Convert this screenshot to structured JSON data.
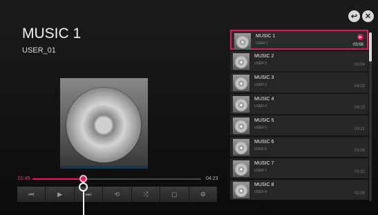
{
  "header": {
    "back_icon": "back-arrow-icon",
    "close_icon": "close-icon",
    "back_glyph": "↩",
    "close_glyph": "✕"
  },
  "now_playing": {
    "title": "MUSIC 1",
    "user": "USER_01",
    "current_time": "01:45",
    "total_time": "04:23",
    "progress": 0.3
  },
  "controls": [
    {
      "name": "previous-icon",
      "glyph": "⏮"
    },
    {
      "name": "play-icon",
      "glyph": "▶"
    },
    {
      "name": "next-icon",
      "glyph": "⏭"
    },
    {
      "name": "repeat-icon",
      "glyph": "⟲"
    },
    {
      "name": "shuffle-icon",
      "glyph": "⤮"
    },
    {
      "name": "screen-off-icon",
      "glyph": "▢"
    },
    {
      "name": "settings-icon",
      "glyph": "⚙"
    }
  ],
  "playlist": [
    {
      "title": "MUSIC 1",
      "artist": "USER 1",
      "duration": "03:56",
      "active": true
    },
    {
      "title": "MUSIC 2",
      "artist": "USER 2",
      "duration": "03:54"
    },
    {
      "title": "MUSIC 3",
      "artist": "USER 3",
      "duration": "04:02"
    },
    {
      "title": "MUSIC 4",
      "artist": "USER 4",
      "duration": "04:15"
    },
    {
      "title": "MUSIC 5",
      "artist": "USER 5",
      "duration": "03:21"
    },
    {
      "title": "MUSIC 6",
      "artist": "USER 6",
      "duration": "03:56"
    },
    {
      "title": "MUSIC 7",
      "artist": "USER 7",
      "duration": "03:32"
    },
    {
      "title": "MUSIC 8",
      "artist": "USER 8",
      "duration": "02:58"
    }
  ],
  "colors": {
    "accent": "#e6185d"
  }
}
